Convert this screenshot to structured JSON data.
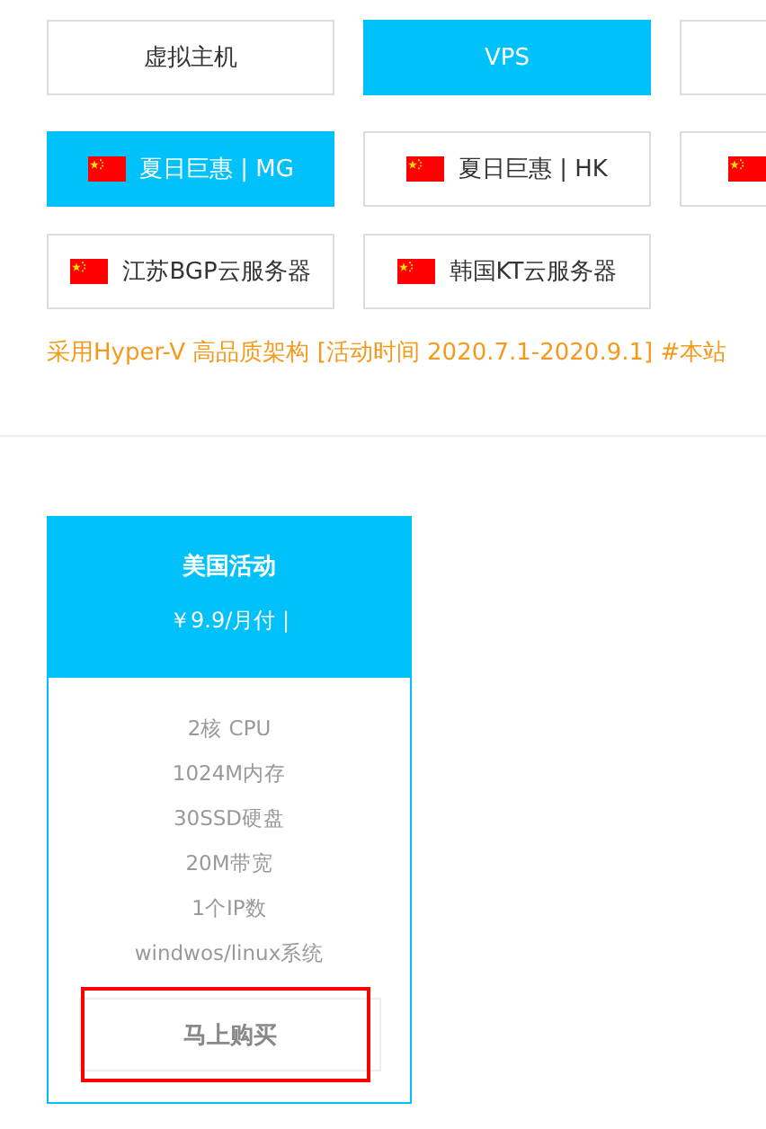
{
  "product_tabs": [
    {
      "label": "虚拟主机",
      "selected": false
    },
    {
      "label": "VPS",
      "selected": true
    },
    {
      "selected": false
    }
  ],
  "region_tabs": [
    {
      "label": "夏日巨惠 | MG",
      "flag": true,
      "selected": true
    },
    {
      "label": "夏日巨惠 | HK",
      "flag": true,
      "selected": false
    },
    {
      "flag": true,
      "selected": false
    },
    {
      "label": "江苏BGP云服务器",
      "flag": true,
      "selected": false
    },
    {
      "label": "韩国KT云服务器",
      "flag": true,
      "selected": false
    }
  ],
  "notice": "采用Hyper-V 高品质架构 [活动时间 2020.7.1-2020.9.1] #本站",
  "plan": {
    "title": "美国活动",
    "price": "￥9.9/月付 |",
    "features": [
      "2核 CPU",
      "1024M内存",
      "30SSD硬盘",
      "20M带宽",
      "1个IP数",
      "windwos/linux系统"
    ],
    "button": "马上购买",
    "highlighted": true
  }
}
